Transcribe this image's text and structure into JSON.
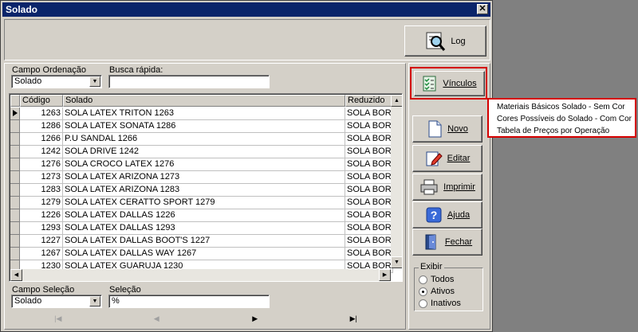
{
  "window": {
    "title": "Solado",
    "close_label": "✕"
  },
  "toolbar": {
    "log_label": "Log"
  },
  "filter": {
    "sort_field_label": "Campo Ordenação",
    "sort_field_value": "Solado",
    "quick_search_label": "Busca rápida:",
    "quick_search_value": ""
  },
  "grid": {
    "columns": [
      "Código",
      "Solado",
      "Reduzido"
    ],
    "rows": [
      {
        "code": "1263",
        "name": "  SOLA LATEX TRITON  1263",
        "short": "SOLA BORRA"
      },
      {
        "code": "1286",
        "name": " SOLA LATEX SONATA 1286",
        "short": "SOLA BORRA"
      },
      {
        "code": "1266",
        "name": "P.U SANDAL 1266",
        "short": "SOLA BORRA"
      },
      {
        "code": "1242",
        "name": "SOLA  DRIVE 1242",
        "short": "SOLA BORRA"
      },
      {
        "code": "1276",
        "name": "SOLA CROCO LATEX 1276",
        "short": "SOLA BORRA"
      },
      {
        "code": "1273",
        "name": "SOLA LATEX ARIZONA  1273",
        "short": "SOLA BORRA"
      },
      {
        "code": "1283",
        "name": "SOLA LATEX ARIZONA  1283",
        "short": "SOLA BORRA"
      },
      {
        "code": "1279",
        "name": "SOLA LATEX CERATTO SPORT 1279",
        "short": "SOLA BORRA"
      },
      {
        "code": "1226",
        "name": "SOLA LATEX DALLAS 1226",
        "short": "SOLA BORRA"
      },
      {
        "code": "1293",
        "name": "SOLA LATEX DALLAS 1293",
        "short": "SOLA BORRA"
      },
      {
        "code": "1227",
        "name": "SOLA LATEX DALLAS BOOT'S 1227",
        "short": "SOLA BORRA"
      },
      {
        "code": "1267",
        "name": "SOLA LATEX DALLAS WAY 1267",
        "short": "SOLA BORRA"
      },
      {
        "code": "1230",
        "name": "SOLA LATEX GUARUJA 1230",
        "short": "SOLA BORRA"
      }
    ]
  },
  "selection": {
    "field_label": "Campo Seleção",
    "field_value": "Solado",
    "value_label": "Seleção",
    "value": "%"
  },
  "nav": {
    "first": "|◀",
    "prev": "◀",
    "next": "▶",
    "last": "▶|"
  },
  "actions": {
    "vinculos": "Vínculos",
    "novo": "Novo",
    "editar": "Editar",
    "imprimir": "Imprimir",
    "ajuda": "Ajuda",
    "fechar": "Fechar"
  },
  "vinculos_menu": [
    "Materiais Básicos Solado - Sem Cor",
    "Cores Possíveis do Solado - Com Cor",
    "Tabela de Preços por Operação"
  ],
  "exibir": {
    "title": "Exibir",
    "options": [
      "Todos",
      "Ativos",
      "Inativos"
    ],
    "selected": "Ativos"
  },
  "colors": {
    "highlight": "#d40000",
    "titlebar": "#0a246a"
  }
}
